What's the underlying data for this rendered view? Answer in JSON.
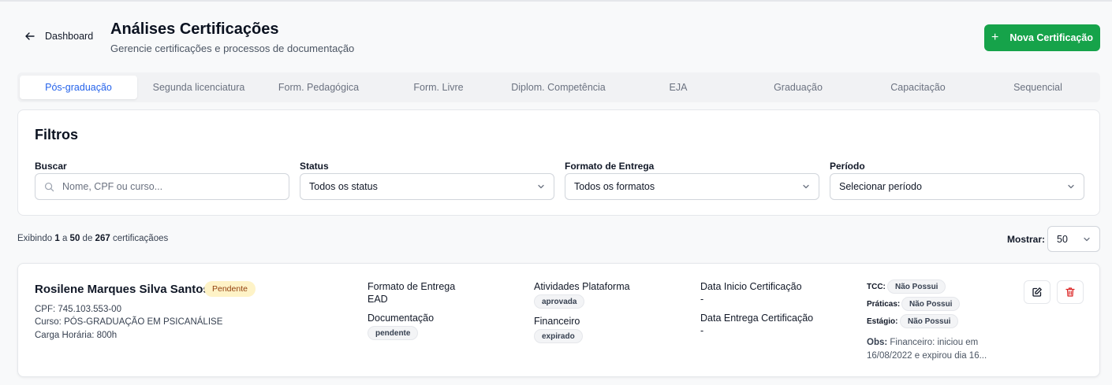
{
  "header": {
    "back_label": "Dashboard",
    "title": "Análises Certificações",
    "subtitle": "Gerencie certificações e processos de documentação",
    "new_button_label": "Nova Certificação"
  },
  "tabs": [
    {
      "label": "Pós-graduação",
      "active": true
    },
    {
      "label": "Segunda licenciatura"
    },
    {
      "label": "Form. Pedagógica"
    },
    {
      "label": "Form. Livre"
    },
    {
      "label": "Diplom. Competência"
    },
    {
      "label": "EJA"
    },
    {
      "label": "Graduação"
    },
    {
      "label": "Capacitação"
    },
    {
      "label": "Sequencial"
    }
  ],
  "filters": {
    "title": "Filtros",
    "search_label": "Buscar",
    "search_placeholder": "Nome, CPF ou curso...",
    "status_label": "Status",
    "status_value": "Todos os status",
    "format_label": "Formato de Entrega",
    "format_value": "Todos os formatos",
    "period_label": "Período",
    "period_value": "Selecionar período"
  },
  "results": {
    "prefix": "Exibindo",
    "from": "1",
    "to_word": "a",
    "to": "50",
    "of_word": "de",
    "total": "267",
    "suffix": "certificaçãoes",
    "show_label": "Mostrar:",
    "show_value": "50"
  },
  "records": [
    {
      "name": "Rosilene Marques Silva Santos",
      "status": "Pendente",
      "cpf": "CPF: 745.103.553-00",
      "course": "Curso: PÓS-GRADUAÇÃO EM PSICANÁLISE",
      "hours": "Carga Horária: 800h",
      "delivery_format_label": "Formato de Entrega",
      "delivery_format": "EAD",
      "documentation_label": "Documentação",
      "documentation": "pendente",
      "activities_label": "Atividades Plataforma",
      "activities": "aprovada",
      "financial_label": "Financeiro",
      "financial": "expirado",
      "start_date_label": "Data Inicio Certificação",
      "start_date": "-",
      "delivery_date_label": "Data Entrega Certificação",
      "delivery_date": "-",
      "tcc_label": "TCC:",
      "tcc": "Não Possui",
      "praticas_label": "Práticas:",
      "praticas": "Não Possui",
      "estagio_label": "Estágio:",
      "estagio": "Não Possui",
      "obs_label": "Obs:",
      "obs": "Financeiro: iniciou em 16/08/2022 e expirou dia 16..."
    }
  ],
  "colors": {
    "primary_green": "#16a34a",
    "active_tab": "#2563eb",
    "pending_bg": "#fef3c7",
    "delete_red": "#dc2626"
  },
  "icons": [
    "arrow-left-icon",
    "plus-icon",
    "search-icon",
    "chevron-down-icon",
    "edit-icon",
    "trash-icon"
  ]
}
